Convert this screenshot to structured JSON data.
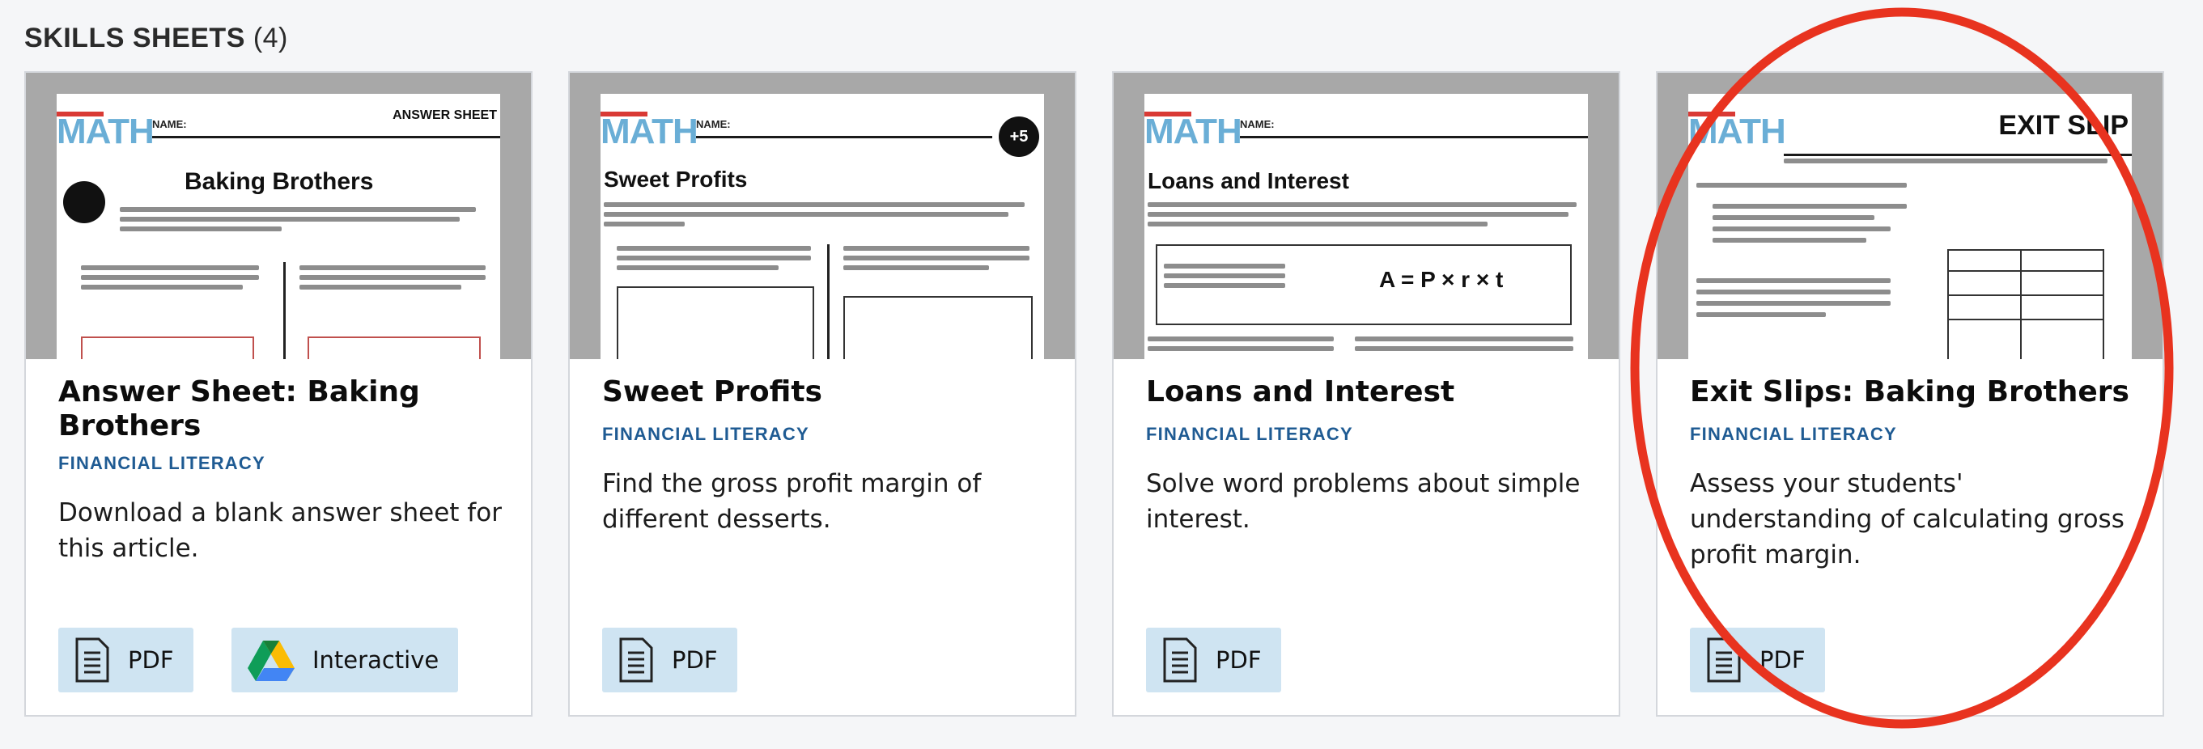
{
  "section": {
    "name": "SKILLS SHEETS",
    "count": "(4)"
  },
  "cards": [
    {
      "title": "Answer Sheet: Baking Brothers",
      "category": "FINANCIAL LITERACY",
      "description": "Download a blank answer sheet for this article.",
      "thumb_heading": "Baking Brothers",
      "thumb_tag": "ANSWER SHEET",
      "buttons": [
        "PDF",
        "Interactive"
      ]
    },
    {
      "title": "Sweet Profits",
      "category": "FINANCIAL LITERACY",
      "description": "Find the gross profit margin of different desserts.",
      "thumb_heading": "Sweet Profits",
      "thumb_tag": "+5",
      "buttons": [
        "PDF"
      ]
    },
    {
      "title": "Loans and Interest",
      "category": "FINANCIAL LITERACY",
      "description": "Solve word problems about simple interest.",
      "thumb_heading": "Loans and Interest",
      "thumb_tag": "",
      "buttons": [
        "PDF"
      ]
    },
    {
      "title": "Exit Slips: Baking Brothers",
      "category": "FINANCIAL LITERACY",
      "description": "Assess your students' understanding of calculating gross profit margin.",
      "thumb_heading": "",
      "thumb_tag": "EXIT SLIP",
      "buttons": [
        "PDF"
      ]
    }
  ],
  "thumb_logo": "MATH",
  "thumb_name_label": "NAME:",
  "icons": {
    "pdf": "document-icon",
    "interactive": "google-drive-icon"
  },
  "colors": {
    "category": "#1f5b93",
    "button_bg": "#cfe4f2",
    "annotation": "#e8331f",
    "card_border": "#d4d7dc"
  }
}
